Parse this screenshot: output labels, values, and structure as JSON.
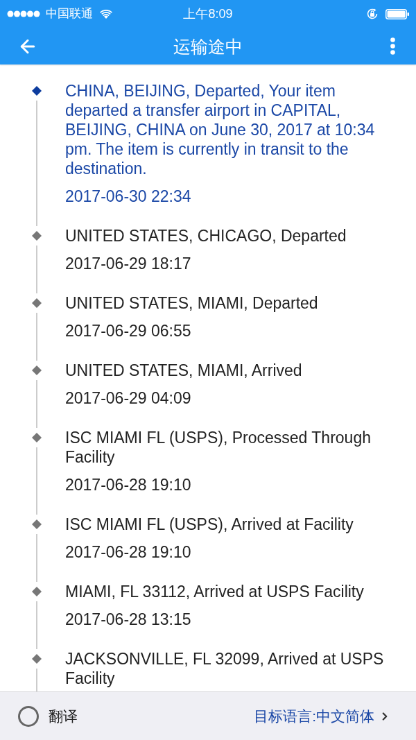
{
  "status_bar": {
    "carrier": "中国联通",
    "time": "上午8:09"
  },
  "app_bar": {
    "title": "运输途中"
  },
  "events": [
    {
      "description": "CHINA, BEIJING, Departed, Your item departed a transfer airport in CAPITAL, BEIJING, CHINA on June 30, 2017 at 10:34 pm. The item is currently in transit to the destination.",
      "time": "2017-06-30 22:34",
      "current": true
    },
    {
      "description": "UNITED STATES, CHICAGO, Departed",
      "time": "2017-06-29 18:17",
      "current": false
    },
    {
      "description": "UNITED STATES, MIAMI, Departed",
      "time": "2017-06-29 06:55",
      "current": false
    },
    {
      "description": "UNITED STATES, MIAMI, Arrived",
      "time": "2017-06-29 04:09",
      "current": false
    },
    {
      "description": "ISC MIAMI FL (USPS), Processed Through Facility",
      "time": "2017-06-28 19:10",
      "current": false
    },
    {
      "description": "ISC MIAMI FL (USPS), Arrived at Facility",
      "time": "2017-06-28 19:10",
      "current": false
    },
    {
      "description": "MIAMI, FL 33112, Arrived at USPS Facility",
      "time": "2017-06-28 13:15",
      "current": false
    },
    {
      "description": "JACKSONVILLE, FL 32099, Arrived at USPS Facility",
      "current": false
    }
  ],
  "footer": {
    "translate": {
      "label": "翻译",
      "checked": false
    },
    "target_language": "目标语言:中文简体"
  }
}
